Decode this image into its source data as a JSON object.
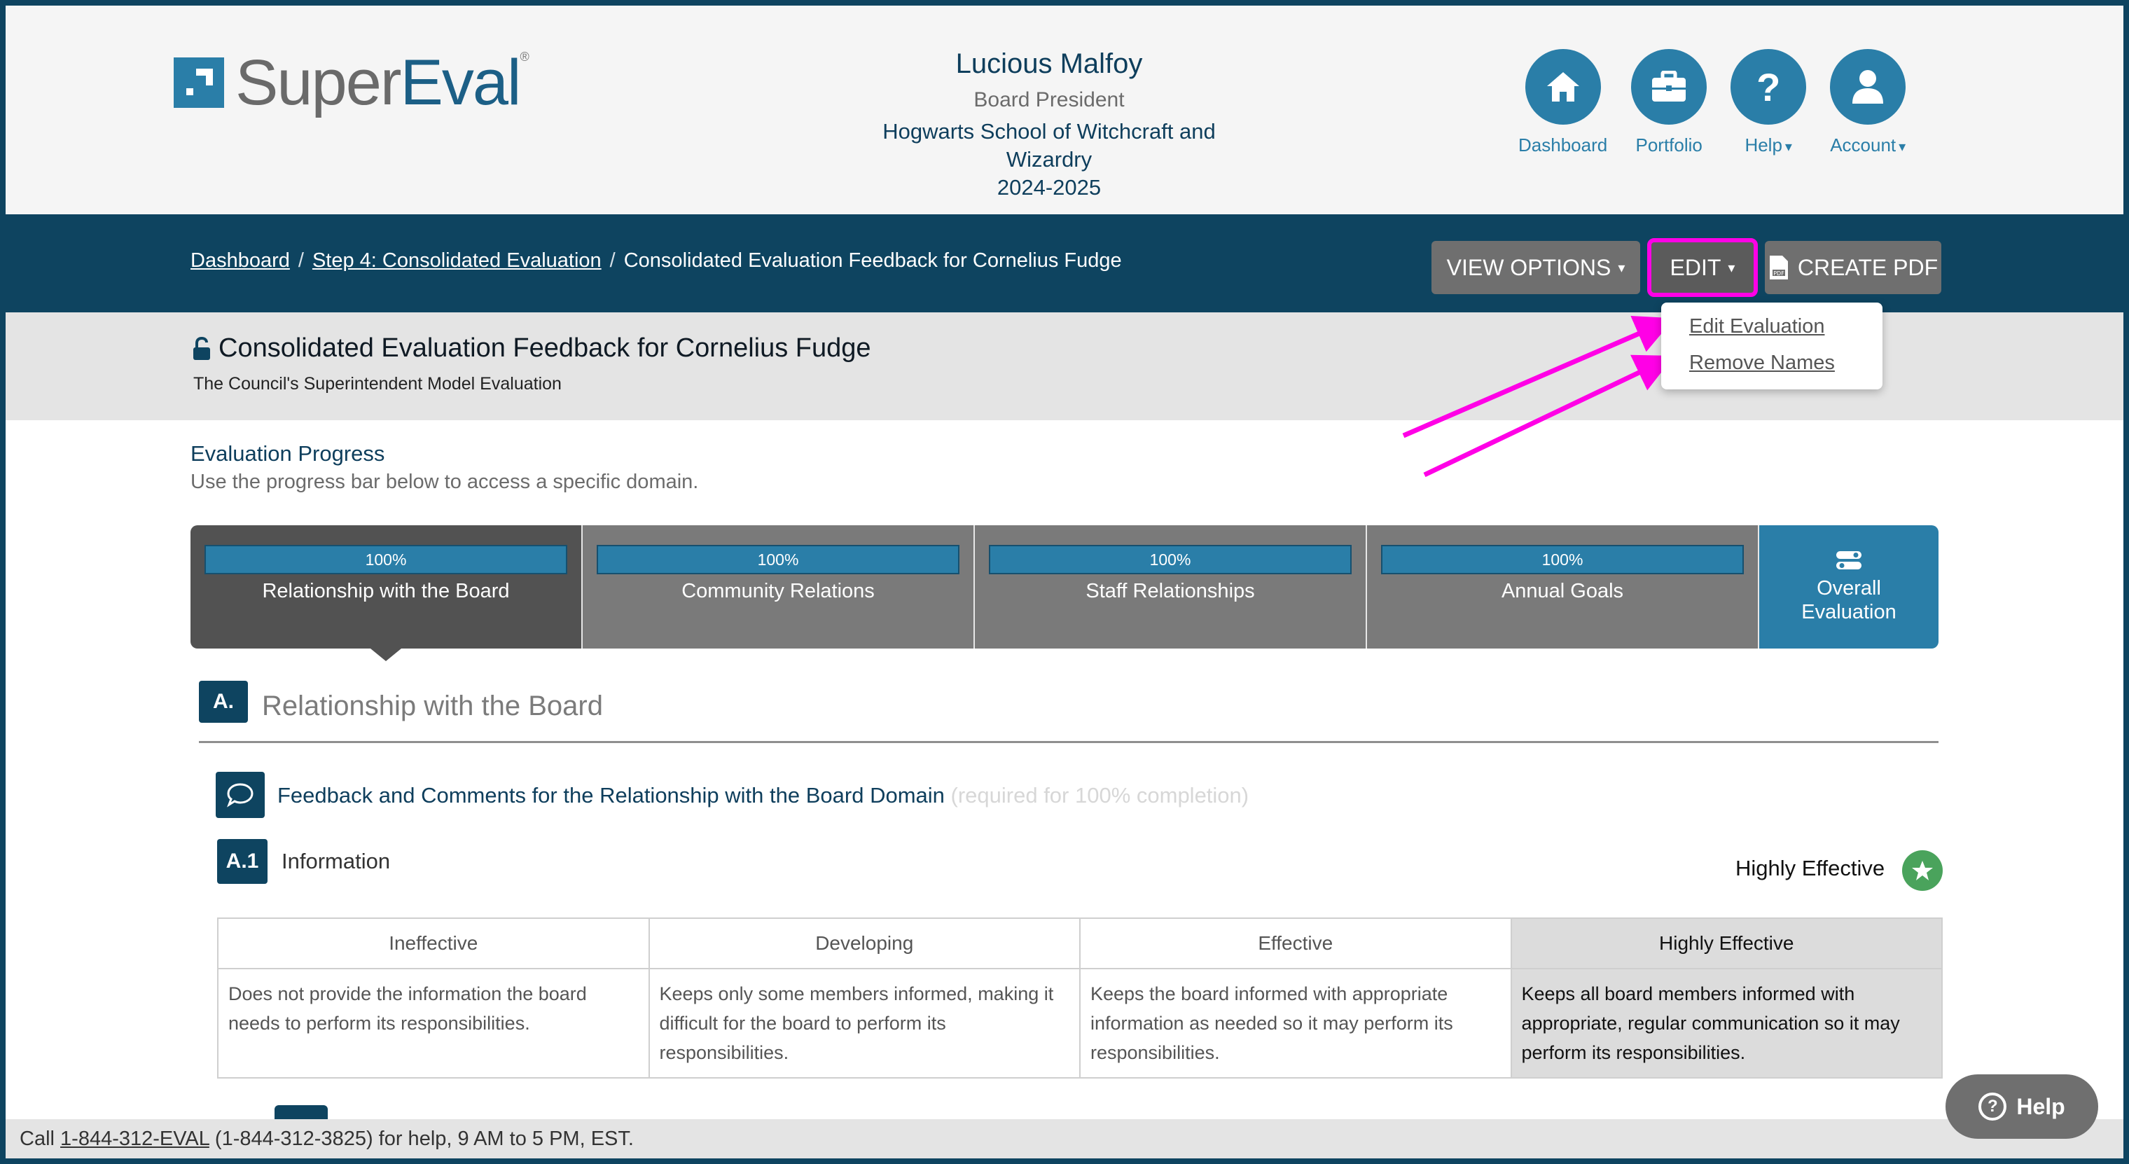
{
  "brand": {
    "name_part1": "Super",
    "name_part2": "Eval",
    "registered": "®"
  },
  "user": {
    "name": "Lucious Malfoy",
    "role": "Board President",
    "organization": "Hogwarts School of Witchcraft and Wizardry",
    "year": "2024-2025"
  },
  "topnav": {
    "items": [
      {
        "label": "Dashboard",
        "icon": "home-icon"
      },
      {
        "label": "Portfolio",
        "icon": "briefcase-icon"
      },
      {
        "label": "Help",
        "icon": "question-icon",
        "caret": "▾"
      },
      {
        "label": "Account",
        "icon": "user-icon",
        "caret": "▾"
      }
    ]
  },
  "breadcrumb": {
    "items": [
      "Dashboard",
      "Step 4: Consolidated Evaluation",
      "Consolidated Evaluation Feedback for Cornelius Fudge"
    ],
    "separator": "/"
  },
  "toolbar": {
    "view_options": "VIEW OPTIONS",
    "edit": "EDIT",
    "create_pdf": "CREATE PDF",
    "caret": "▾",
    "edit_menu": [
      "Edit Evaluation",
      "Remove Names"
    ]
  },
  "page": {
    "title": "Consolidated Evaluation Feedback for Cornelius Fudge",
    "subtitle": "The Council's Superintendent Model Evaluation"
  },
  "progress": {
    "title": "Evaluation Progress",
    "description": "Use the progress bar below to access a specific domain.",
    "domains": [
      {
        "label": "Relationship with the Board",
        "percent": "100%",
        "active": true
      },
      {
        "label": "Community Relations",
        "percent": "100%",
        "active": false
      },
      {
        "label": "Staff Relationships",
        "percent": "100%",
        "active": false
      },
      {
        "label": "Annual Goals",
        "percent": "100%",
        "active": false
      }
    ],
    "overall_label": "Overall Evaluation"
  },
  "domain": {
    "badge": "A.",
    "title": "Relationship with the Board",
    "feedback_label": "Feedback and Comments for the Relationship with the Board Domain",
    "feedback_required": "(required for 100% completion)"
  },
  "indicator": {
    "badge": "A.1",
    "title": "Information",
    "rating": "Highly Effective",
    "rubric_headers": [
      "Ineffective",
      "Developing",
      "Effective",
      "Highly Effective"
    ],
    "rubric_cells": [
      "Does not provide the information the board needs to perform its responsibilities.",
      "Keeps only some members informed, making it difficult for the board to perform its responsibilities.",
      "Keeps the board informed with appropriate information as needed so it may perform its responsibilities.",
      "Keeps all board members informed with appropriate, regular communication so it may perform its responsibilities."
    ]
  },
  "footer": {
    "prefix": "Call",
    "phone_link": "1-844-312-EVAL",
    "suffix": "(1-844-312-3825) for help, 9 AM to 5 PM, EST."
  },
  "help_button": {
    "label": "Help"
  },
  "colors": {
    "primary": "#2a7ea8",
    "navy": "#0e4460",
    "annotation": "#ff00e6",
    "success": "#4aa35c"
  }
}
